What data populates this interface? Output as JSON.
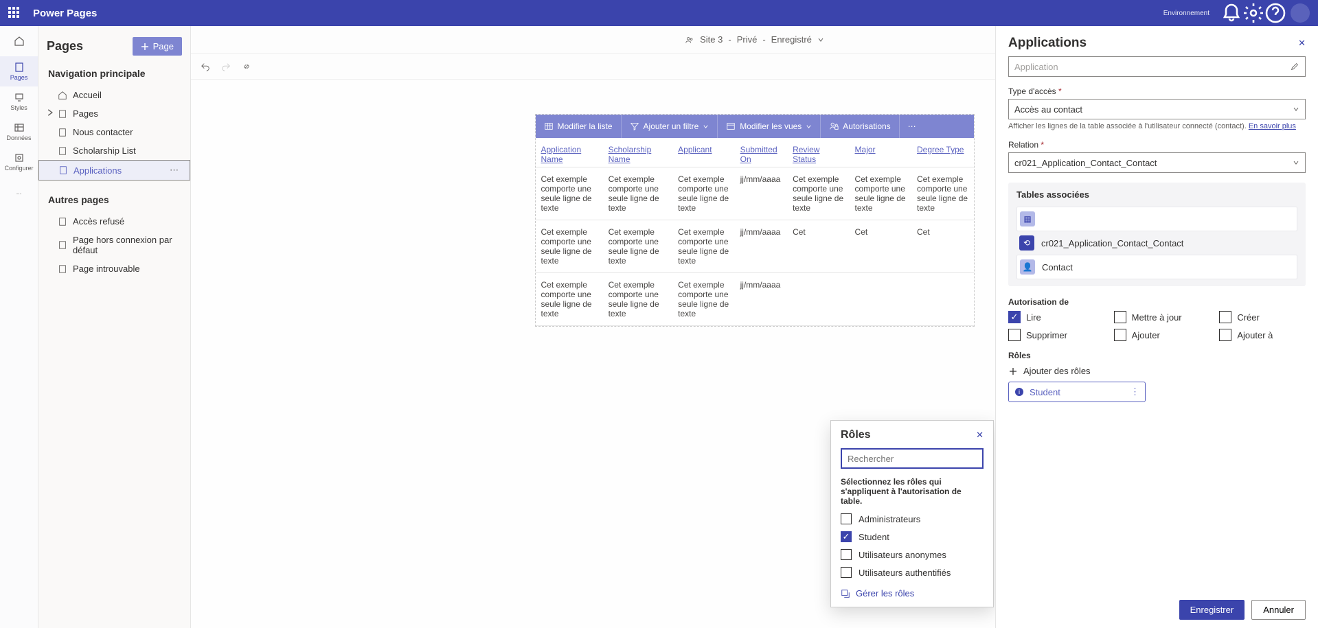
{
  "topbar": {
    "product": "Power Pages",
    "env_label": "Environnement",
    "env_value": ""
  },
  "rail": {
    "items": [
      "Pages",
      "Styles",
      "Données",
      "Configurer",
      "..."
    ]
  },
  "nav": {
    "title": "Pages",
    "add_page": "Page",
    "section1": "Navigation principale",
    "section2": "Autres pages",
    "items": [
      "Accueil",
      "Pages",
      "Nous contacter",
      "Scholarship List",
      "Applications"
    ],
    "other": [
      "Accès refusé",
      "Page hors connexion par défaut",
      "Page introuvable"
    ]
  },
  "crumb": {
    "site": "Site 3",
    "visibility": "Privé",
    "status": "Enregistré"
  },
  "list": {
    "actions": [
      "Modifier la liste",
      "Ajouter un filtre",
      "Modifier les vues",
      "Autorisations"
    ],
    "headers": [
      "Application Name",
      "Scholarship Name",
      "Applicant",
      "Submitted On",
      "Review Status",
      "Major",
      "Degree Type"
    ],
    "sample_text": "Cet exemple comporte une seule ligne de texte",
    "sample_date": "jj/mm/aaaa",
    "sample_short": "Cet"
  },
  "panel": {
    "title": "Applications",
    "table_field": "Application",
    "access_type_label": "Type d'accès",
    "access_type_value": "Accès au contact",
    "access_hint": "Afficher les lignes de la table associée à l'utilisateur connecté (contact).",
    "learn_more": "En savoir plus",
    "relation_label": "Relation",
    "relation_value": "cr021_Application_Contact_Contact",
    "assoc_title": "Tables associées",
    "assoc_rel": "cr021_Application_Contact_Contact",
    "assoc_contact": "Contact",
    "perm_title": "Autorisation de",
    "perms": {
      "read": "Lire",
      "update": "Mettre à jour",
      "create": "Créer",
      "delete": "Supprimer",
      "add": "Ajouter",
      "addto": "Ajouter à"
    },
    "roles_title": "Rôles",
    "add_roles": "Ajouter des rôles",
    "role_chip": "Student",
    "save": "Enregistrer",
    "cancel": "Annuler"
  },
  "roles_popup": {
    "title": "Rôles",
    "search_ph": "Rechercher",
    "desc": "Sélectionnez les rôles qui s'appliquent à l'autorisation de table.",
    "options": [
      "Administrateurs",
      "Student",
      "Utilisateurs anonymes",
      "Utilisateurs authentifiés"
    ],
    "manage": "Gérer les rôles"
  }
}
